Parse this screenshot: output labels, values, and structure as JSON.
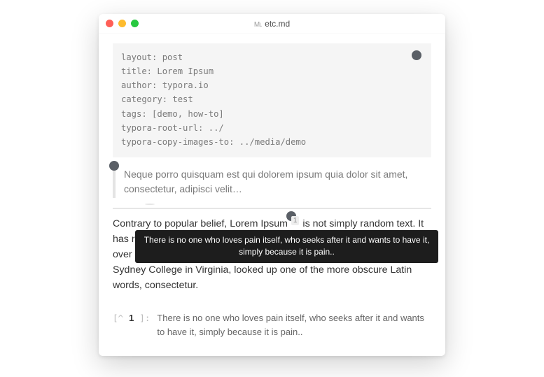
{
  "window": {
    "title": "etc.md"
  },
  "frontmatter": {
    "lines": [
      "layout: post",
      "title: Lorem Ipsum",
      "author: typora.io",
      "category: test",
      "tags: [demo, how-to]",
      "typora-root-url: ../",
      "typora-copy-images-to: ../media/demo"
    ]
  },
  "blockquote": {
    "text": "Neque porro quisquam est qui dolorem ipsum quia dolor sit amet, consectetur, adipisci velit…"
  },
  "paragraph": {
    "pre": "Contrary to popular belief, Lorem Ipsum ",
    "ref": "1",
    "post": " is not simply random text. It has roots in a piece of classical Latin literature from 45 BC, making it over 2000 years old. Richard McClintock, a Latin professor at Hampden-Sydney College in Virginia, looked up one of the more obscure Latin words, consectetur."
  },
  "tooltip": {
    "text": "There is no one who loves pain itself, who seeks after it and wants to have it, simply because it is pain.."
  },
  "footnote": {
    "marker_open": "[^",
    "num": "1",
    "marker_close": "]:",
    "text": "There is no one who loves pain itself, who seeks after it and wants to have it, simply because it is pain.."
  }
}
